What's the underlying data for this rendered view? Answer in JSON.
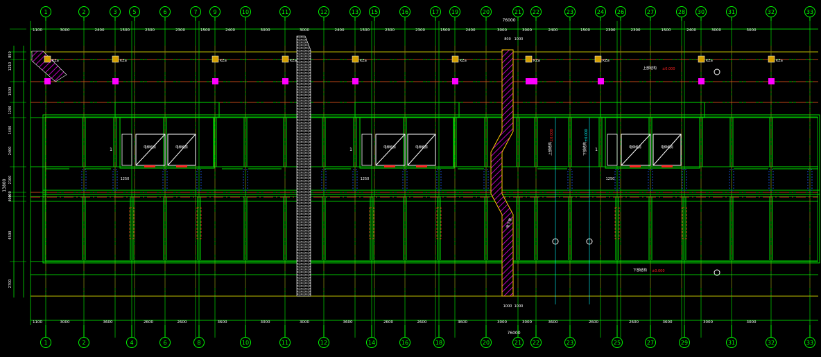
{
  "drawing": {
    "total_dim_top": "76000",
    "total_dim_bottom": "76000",
    "colors": {
      "background": "#000000",
      "axis_line": "#00ff00",
      "wall": "#00e000",
      "red_line": "#ff2020",
      "yellow_line": "#ffff00",
      "cyan": "#00ffff",
      "white": "#ffffff",
      "magenta": "#ff00ff",
      "column_yellow": "#d4a000",
      "hatch": "#c000c0"
    }
  },
  "top_axes": [
    {
      "label": "1",
      "icon": "axis-bubble"
    },
    {
      "label": "2",
      "icon": "axis-bubble"
    },
    {
      "label": "3",
      "icon": "axis-bubble"
    },
    {
      "label": "5",
      "icon": "axis-bubble"
    },
    {
      "label": "6",
      "icon": "axis-bubble"
    },
    {
      "label": "7",
      "icon": "axis-bubble"
    },
    {
      "label": "9",
      "icon": "axis-bubble"
    },
    {
      "label": "10",
      "icon": "axis-bubble"
    },
    {
      "label": "11",
      "icon": "axis-bubble"
    },
    {
      "label": "12",
      "icon": "axis-bubble"
    },
    {
      "label": "13",
      "icon": "axis-bubble"
    },
    {
      "label": "15",
      "icon": "axis-bubble"
    },
    {
      "label": "16",
      "icon": "axis-bubble"
    },
    {
      "label": "17",
      "icon": "axis-bubble"
    },
    {
      "label": "19",
      "icon": "axis-bubble"
    },
    {
      "label": "20",
      "icon": "axis-bubble"
    },
    {
      "label": "21",
      "icon": "axis-bubble"
    },
    {
      "label": "22",
      "icon": "axis-bubble"
    },
    {
      "label": "23",
      "icon": "axis-bubble"
    },
    {
      "label": "24",
      "icon": "axis-bubble"
    },
    {
      "label": "26",
      "icon": "axis-bubble"
    },
    {
      "label": "27",
      "icon": "axis-bubble"
    },
    {
      "label": "28",
      "icon": "axis-bubble"
    },
    {
      "label": "30",
      "icon": "axis-bubble"
    },
    {
      "label": "31",
      "icon": "axis-bubble"
    },
    {
      "label": "32",
      "icon": "axis-bubble"
    },
    {
      "label": "33",
      "icon": "axis-bubble"
    }
  ],
  "bottom_axes": [
    {
      "label": "1"
    },
    {
      "label": "2"
    },
    {
      "label": "4"
    },
    {
      "label": "6"
    },
    {
      "label": "8"
    },
    {
      "label": "10"
    },
    {
      "label": "11"
    },
    {
      "label": "12"
    },
    {
      "label": "14"
    },
    {
      "label": "16"
    },
    {
      "label": "18"
    },
    {
      "label": "20"
    },
    {
      "label": "21"
    },
    {
      "label": "22"
    },
    {
      "label": "23"
    },
    {
      "label": "25"
    },
    {
      "label": "27"
    },
    {
      "label": "29"
    },
    {
      "label": "31"
    },
    {
      "label": "32"
    },
    {
      "label": "33"
    }
  ],
  "top_dims": [
    "1100",
    "3000",
    "2400",
    "1500",
    "2300",
    "2300",
    "1500",
    "2400",
    "3000",
    "3000",
    "2400",
    "1500",
    "2300",
    "2300",
    "1500",
    "2400",
    "3000",
    "3000",
    "2400",
    "1500",
    "2300",
    "2300",
    "1500",
    "2400",
    "3000",
    "3000"
  ],
  "bottom_dims": [
    "1100",
    "3000",
    "3600",
    "2600",
    "2600",
    "3600",
    "3000",
    "3000",
    "3600",
    "2600",
    "2600",
    "3600",
    "3000",
    "3000",
    "3600",
    "2600",
    "2600",
    "3600",
    "3000",
    "3000"
  ],
  "left_dims": [
    "850",
    "1210",
    "1500",
    "1200",
    "1400",
    "2400",
    "2100",
    "400",
    "400",
    "4500",
    "2700"
  ],
  "left_total": "13800",
  "gap_dims": {
    "top": [
      "800",
      "1000"
    ],
    "bottom": [
      "1000",
      "1000"
    ]
  },
  "column_tags": [
    "KZa",
    "KZa",
    "KZa",
    "KZa",
    "KZa",
    "KZa",
    "KZa",
    "KZa",
    "KZa",
    "KZa",
    "KZa"
  ],
  "small_texts": {
    "stair_left": "电梯机房",
    "stair_right": "电梯机房",
    "section_mark": "1",
    "width_1250": "1250",
    "roof_label": "上部结构",
    "under_label": "下部结构",
    "elev_red": "±0.000",
    "mid_note": "地下室"
  }
}
